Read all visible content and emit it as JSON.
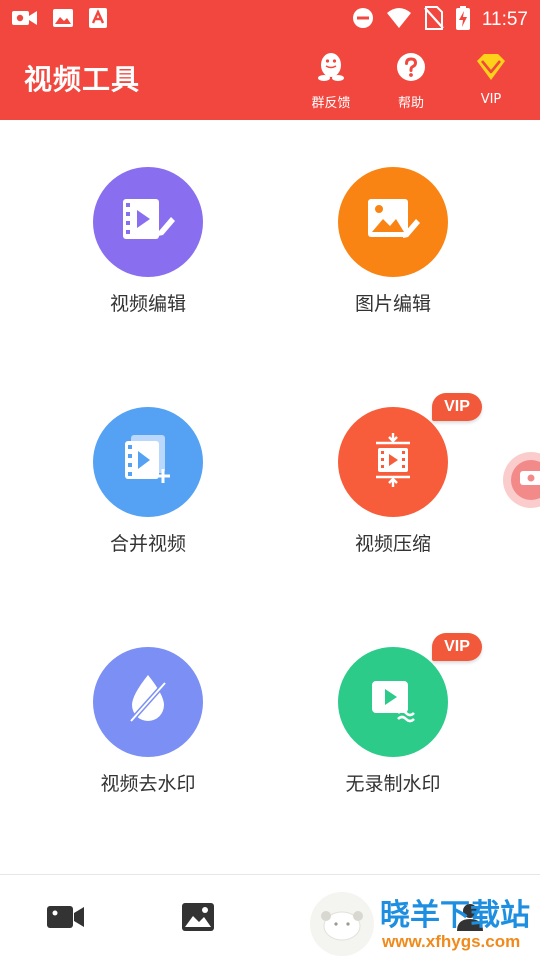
{
  "status_bar": {
    "time": "11:57",
    "icons_left": [
      "video-record-icon",
      "image-icon",
      "app-icon"
    ],
    "icons_right": [
      "dnd-icon",
      "wifi-icon",
      "no-sim-icon",
      "battery-charging-icon"
    ]
  },
  "app_bar": {
    "title": "视频工具",
    "background_color": "#f2473f",
    "actions": [
      {
        "label": "群反馈",
        "icon": "qq-penguin-icon"
      },
      {
        "label": "帮助",
        "icon": "help-question-icon"
      },
      {
        "label": "VIP",
        "icon": "vip-diamond-icon"
      }
    ]
  },
  "tools": [
    {
      "label": "视频编辑",
      "icon": "video-edit-icon",
      "color": "#8a6ef0",
      "vip": false
    },
    {
      "label": "图片编辑",
      "icon": "image-edit-icon",
      "color": "#f98414",
      "vip": false
    },
    {
      "label": "合并视频",
      "icon": "video-merge-icon",
      "color": "#55a2f5",
      "vip": false
    },
    {
      "label": "视频压缩",
      "icon": "video-compress-icon",
      "color": "#f75d3a",
      "vip": true,
      "badge": "VIP"
    },
    {
      "label": "视频去水印",
      "icon": "remove-watermark-icon",
      "color": "#7b8ff5",
      "vip": false
    },
    {
      "label": "无录制水印",
      "icon": "no-record-watermark-icon",
      "color": "#2ccb8a",
      "vip": true,
      "badge": "VIP"
    }
  ],
  "bottom_nav": [
    {
      "icon": "video-camera-icon"
    },
    {
      "icon": "gallery-icon"
    },
    {
      "icon": "profile-icon"
    }
  ],
  "watermark": {
    "site_name": "晓羊下载站",
    "url": "www.xfhygs.com"
  }
}
